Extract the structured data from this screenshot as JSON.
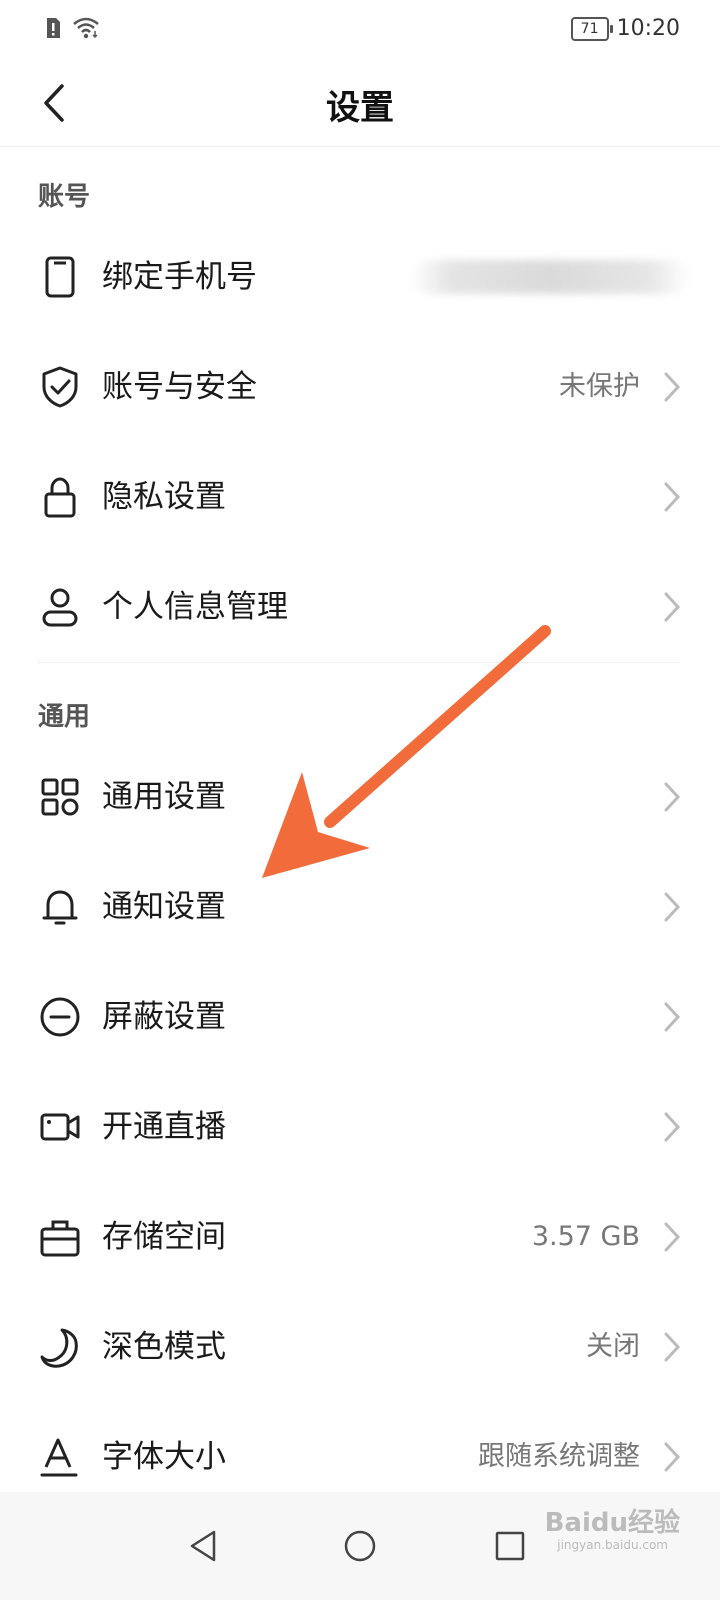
{
  "status_bar": {
    "battery": "71",
    "time": "10:20",
    "icons": [
      "sim-alert-icon",
      "wifi-icon",
      "battery-icon"
    ]
  },
  "header": {
    "title": "设置",
    "back_icon": "chevron-left-icon"
  },
  "sections": [
    {
      "label": "账号",
      "items": [
        {
          "label": "绑定手机号",
          "value": "",
          "icon": "phone-icon",
          "value_blurred": true
        },
        {
          "label": "账号与安全",
          "value": "未保护",
          "icon": "shield-check-icon"
        },
        {
          "label": "隐私设置",
          "value": "",
          "icon": "lock-icon"
        },
        {
          "label": "个人信息管理",
          "value": "",
          "icon": "person-icon"
        }
      ]
    },
    {
      "label": "通用",
      "items": [
        {
          "label": "通用设置",
          "value": "",
          "icon": "grid-icon"
        },
        {
          "label": "通知设置",
          "value": "",
          "icon": "bell-icon"
        },
        {
          "label": "屏蔽设置",
          "value": "",
          "icon": "block-icon"
        },
        {
          "label": "开通直播",
          "value": "",
          "icon": "video-camera-icon"
        },
        {
          "label": "存储空间",
          "value": "3.57 GB",
          "icon": "storage-icon"
        },
        {
          "label": "深色模式",
          "value": "关闭",
          "icon": "moon-icon"
        },
        {
          "label": "字体大小",
          "value": "跟随系统调整",
          "icon": "font-size-icon"
        }
      ]
    }
  ],
  "nav_bar": {
    "buttons": [
      "nav-back-icon",
      "nav-home-icon",
      "nav-recents-icon"
    ]
  },
  "annotation": {
    "color": "#f26b3a"
  },
  "watermark": {
    "text": "Baidu经验",
    "sub": "jingyan.baidu.com"
  }
}
